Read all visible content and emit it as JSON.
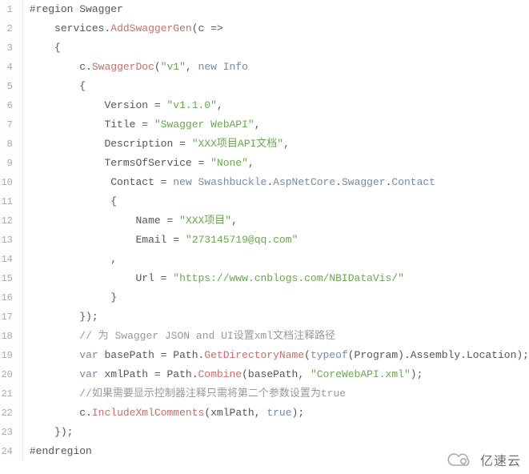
{
  "watermark": {
    "text": "亿速云"
  },
  "code": {
    "lines": [
      {
        "n": 1,
        "tokens": [
          {
            "c": "t-ident",
            "t": "#region"
          },
          {
            "c": "t-ident",
            "t": " Swagger"
          }
        ]
      },
      {
        "n": 2,
        "tokens": [
          {
            "c": "t-ident",
            "t": "    services"
          },
          {
            "c": "t-punct",
            "t": "."
          },
          {
            "c": "t-method",
            "t": "AddSwaggerGen"
          },
          {
            "c": "t-punct",
            "t": "(c "
          },
          {
            "c": "t-punct",
            "t": "=>"
          }
        ]
      },
      {
        "n": 3,
        "tokens": [
          {
            "c": "t-punct",
            "t": "    {"
          }
        ]
      },
      {
        "n": 4,
        "tokens": [
          {
            "c": "t-ident",
            "t": "        c"
          },
          {
            "c": "t-punct",
            "t": "."
          },
          {
            "c": "t-method",
            "t": "SwaggerDoc"
          },
          {
            "c": "t-punct",
            "t": "("
          },
          {
            "c": "t-string",
            "t": "\"v1\""
          },
          {
            "c": "t-punct",
            "t": ", "
          },
          {
            "c": "t-keyword",
            "t": "new"
          },
          {
            "c": "t-punct",
            "t": " "
          },
          {
            "c": "t-type",
            "t": "Info"
          }
        ]
      },
      {
        "n": 5,
        "tokens": [
          {
            "c": "t-punct",
            "t": "        {"
          }
        ]
      },
      {
        "n": 6,
        "tokens": [
          {
            "c": "t-ident",
            "t": "            Version "
          },
          {
            "c": "t-punct",
            "t": "= "
          },
          {
            "c": "t-string",
            "t": "\"v1.1.0\""
          },
          {
            "c": "t-punct",
            "t": ","
          }
        ]
      },
      {
        "n": 7,
        "tokens": [
          {
            "c": "t-ident",
            "t": "            Title "
          },
          {
            "c": "t-punct",
            "t": "= "
          },
          {
            "c": "t-string",
            "t": "\"Swagger WebAPI\""
          },
          {
            "c": "t-punct",
            "t": ","
          }
        ]
      },
      {
        "n": 8,
        "tokens": [
          {
            "c": "t-ident",
            "t": "            Description "
          },
          {
            "c": "t-punct",
            "t": "= "
          },
          {
            "c": "t-string",
            "t": "\"XXX项目API文档\""
          },
          {
            "c": "t-punct",
            "t": ","
          }
        ]
      },
      {
        "n": 9,
        "tokens": [
          {
            "c": "t-ident",
            "t": "            TermsOfService "
          },
          {
            "c": "t-punct",
            "t": "= "
          },
          {
            "c": "t-string",
            "t": "\"None\""
          },
          {
            "c": "t-punct",
            "t": ","
          }
        ]
      },
      {
        "n": 10,
        "tokens": [
          {
            "c": "t-ident",
            "t": "             Contact "
          },
          {
            "c": "t-punct",
            "t": "= "
          },
          {
            "c": "t-keyword",
            "t": "new"
          },
          {
            "c": "t-punct",
            "t": " "
          },
          {
            "c": "t-type",
            "t": "Swashbuckle"
          },
          {
            "c": "t-punct",
            "t": "."
          },
          {
            "c": "t-type",
            "t": "AspNetCore"
          },
          {
            "c": "t-punct",
            "t": "."
          },
          {
            "c": "t-type",
            "t": "Swagger"
          },
          {
            "c": "t-punct",
            "t": "."
          },
          {
            "c": "t-type",
            "t": "Contact"
          }
        ]
      },
      {
        "n": 11,
        "tokens": [
          {
            "c": "t-punct",
            "t": "             {"
          }
        ]
      },
      {
        "n": 12,
        "tokens": [
          {
            "c": "t-ident",
            "t": "                 Name "
          },
          {
            "c": "t-punct",
            "t": "= "
          },
          {
            "c": "t-string",
            "t": "\"XXX项目\""
          },
          {
            "c": "t-punct",
            "t": ","
          }
        ]
      },
      {
        "n": 13,
        "tokens": [
          {
            "c": "t-ident",
            "t": "                 Email "
          },
          {
            "c": "t-punct",
            "t": "= "
          },
          {
            "c": "t-string",
            "t": "\"273145719@qq.com\""
          }
        ]
      },
      {
        "n": 14,
        "tokens": [
          {
            "c": "t-punct",
            "t": "             ,"
          }
        ]
      },
      {
        "n": 15,
        "tokens": [
          {
            "c": "t-ident",
            "t": "                 Url "
          },
          {
            "c": "t-punct",
            "t": "= "
          },
          {
            "c": "t-string",
            "t": "\"https://www.cnblogs.com/NBIDataVis/\""
          }
        ]
      },
      {
        "n": 16,
        "tokens": [
          {
            "c": "t-punct",
            "t": "             }"
          }
        ]
      },
      {
        "n": 17,
        "tokens": [
          {
            "c": "t-punct",
            "t": "        });"
          }
        ]
      },
      {
        "n": 18,
        "tokens": [
          {
            "c": "t-punct",
            "t": "        "
          },
          {
            "c": "t-comment",
            "t": "// 为 Swagger JSON and UI设置xml文档注释路径"
          }
        ]
      },
      {
        "n": 19,
        "tokens": [
          {
            "c": "t-punct",
            "t": "        "
          },
          {
            "c": "t-keyword",
            "t": "var"
          },
          {
            "c": "t-ident",
            "t": " basePath "
          },
          {
            "c": "t-punct",
            "t": "= Path."
          },
          {
            "c": "t-method",
            "t": "GetDirectoryName"
          },
          {
            "c": "t-punct",
            "t": "("
          },
          {
            "c": "t-keyword",
            "t": "typeof"
          },
          {
            "c": "t-punct",
            "t": "(Program).Assembly.Location);"
          }
        ]
      },
      {
        "n": 20,
        "tokens": [
          {
            "c": "t-punct",
            "t": "        "
          },
          {
            "c": "t-keyword",
            "t": "var"
          },
          {
            "c": "t-ident",
            "t": " xmlPath "
          },
          {
            "c": "t-punct",
            "t": "= Path."
          },
          {
            "c": "t-method",
            "t": "Combine"
          },
          {
            "c": "t-punct",
            "t": "(basePath, "
          },
          {
            "c": "t-string",
            "t": "\"CoreWebAPI.xml\""
          },
          {
            "c": "t-punct",
            "t": ");"
          }
        ]
      },
      {
        "n": 21,
        "tokens": [
          {
            "c": "t-punct",
            "t": "        "
          },
          {
            "c": "t-comment",
            "t": "//如果需要显示控制器注释只需将第二个参数设置为true"
          }
        ]
      },
      {
        "n": 22,
        "tokens": [
          {
            "c": "t-ident",
            "t": "        c"
          },
          {
            "c": "t-punct",
            "t": "."
          },
          {
            "c": "t-method",
            "t": "IncludeXmlComments"
          },
          {
            "c": "t-punct",
            "t": "(xmlPath, "
          },
          {
            "c": "t-keyword",
            "t": "true"
          },
          {
            "c": "t-punct",
            "t": ");"
          }
        ]
      },
      {
        "n": 23,
        "tokens": [
          {
            "c": "t-punct",
            "t": "    });"
          }
        ]
      },
      {
        "n": 24,
        "tokens": [
          {
            "c": "t-ident",
            "t": "#endregion"
          }
        ]
      }
    ]
  }
}
